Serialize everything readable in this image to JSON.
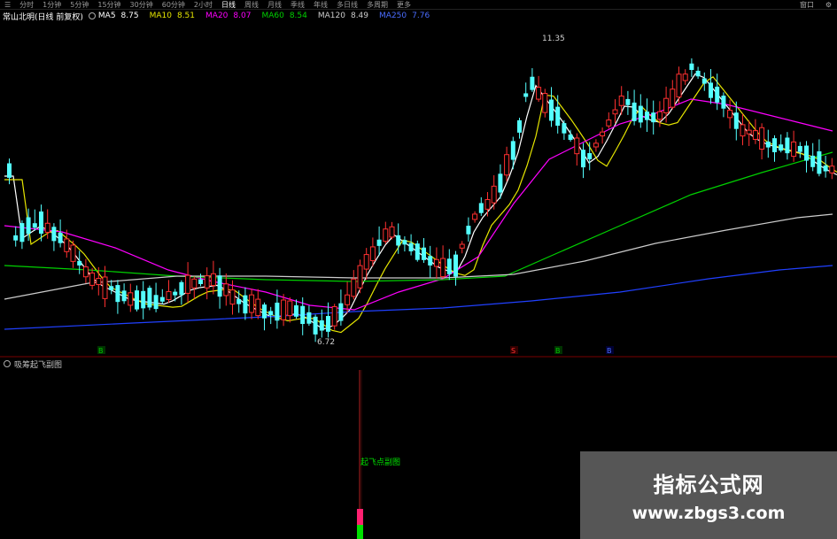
{
  "toolbar": {
    "period_tabs": [
      "分时",
      "1分钟",
      "5分钟",
      "15分钟",
      "30分钟",
      "60分钟",
      "2小时",
      "日线",
      "周线",
      "月线",
      "季线",
      "年线",
      "多日线",
      "更多",
      "多周期",
      "更多"
    ],
    "active_tab_index": 7,
    "right_label": "窗口"
  },
  "info_row": {
    "stock_label": "常山北明(日线 前复权)",
    "ma_items": [
      {
        "name": "MA5",
        "value": "8.75",
        "color": "#ffffff"
      },
      {
        "name": "MA10",
        "value": "8.51",
        "color": "#e5e500"
      },
      {
        "name": "MA20",
        "value": "8.07",
        "color": "#ff00ff"
      },
      {
        "name": "MA60",
        "value": "8.54",
        "color": "#00d000"
      },
      {
        "name": "MA120",
        "value": "8.49",
        "color": "#cccccc"
      },
      {
        "name": "MA250",
        "value": "7.76",
        "color": "#4a6cff"
      }
    ]
  },
  "chart_annotations": {
    "high_price_label": "11.35",
    "low_price_label": "6.72",
    "signal_markers": [
      {
        "label": "B",
        "color": "#00c000"
      },
      {
        "label": "S",
        "color": "#ff3030"
      },
      {
        "label": "B",
        "color": "#00c000"
      },
      {
        "label": "B",
        "color": "#4a6cff"
      }
    ]
  },
  "indicator": {
    "name": "吸筹起飞副图",
    "signal_text": "起飞点副图"
  },
  "watermark": {
    "title": "指标公式网",
    "url": "www.zbgs3.com"
  },
  "colors": {
    "up_candle": "#ff3030",
    "down_candle": "#54ffff",
    "background": "#000000"
  }
}
